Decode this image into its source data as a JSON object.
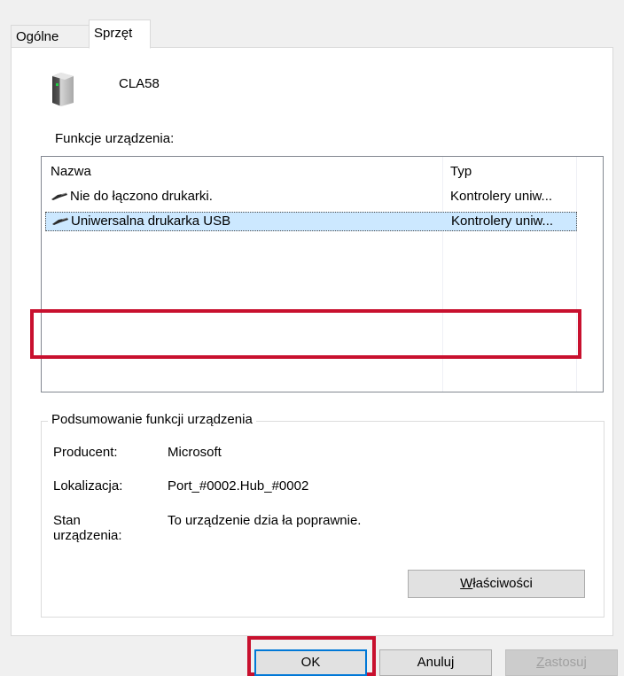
{
  "tabs": [
    {
      "label": "Ogólne",
      "active": false
    },
    {
      "label": "Sprzęt",
      "active": true
    }
  ],
  "device": {
    "name": "CLA58",
    "icon": "computer-tower-icon"
  },
  "functions_label": "Funkcje urządzenia:",
  "list": {
    "columns": [
      "Nazwa",
      "Typ"
    ],
    "rows": [
      {
        "name": "Nie do łączono drukarki.",
        "type": "Kontrolery uniw...",
        "icon": "usb-cable-icon",
        "selected": false
      },
      {
        "name": "Uniwersalna drukarka USB",
        "type": "Kontrolery uniw...",
        "icon": "usb-cable-icon",
        "selected": true
      }
    ]
  },
  "summary": {
    "title": "Podsumowanie funkcji urządzenia",
    "manufacturer_label": "Producent:",
    "manufacturer_value": "Microsoft",
    "location_label": "Lokalizacja:",
    "location_value": "Port_#0002.Hub_#0002",
    "status_label_1": "Stan",
    "status_label_2": "urządzenia:",
    "status_value": "To urządzenie dzia ła poprawnie.",
    "properties_button_mnemonic": "W",
    "properties_button_rest": "łaściwości"
  },
  "buttons": {
    "ok": "OK",
    "cancel": "Anuluj",
    "apply_mnemonic": "Z",
    "apply_rest": "astosuj"
  },
  "colors": {
    "highlight_red": "#c8102e",
    "selection": "#cce8ff",
    "default_button_border": "#0078d7"
  }
}
